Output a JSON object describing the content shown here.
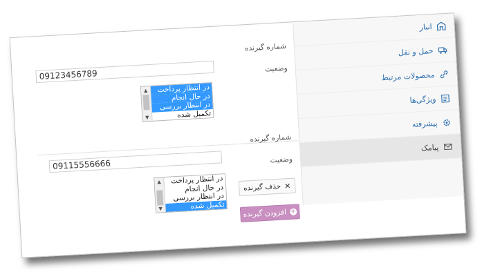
{
  "sidebar": {
    "items": [
      {
        "label": "انبار",
        "icon": "warehouse-icon"
      },
      {
        "label": "حمل و نقل",
        "icon": "truck-icon"
      },
      {
        "label": "محصولات مرتبط",
        "icon": "link-icon"
      },
      {
        "label": "ویژگی‌ها",
        "icon": "list-box-icon"
      },
      {
        "label": "پیشرفته",
        "icon": "gear-icon"
      },
      {
        "label": "پیامک",
        "icon": "envelope-icon"
      }
    ]
  },
  "recipients": [
    {
      "number_label": "شماره گیرنده",
      "number_value": "09123456789",
      "status_label": "وضعیت",
      "status_options": [
        {
          "label": "در انتظار پرداخت",
          "selected": true
        },
        {
          "label": "در حال انجام",
          "selected": true
        },
        {
          "label": "در انتظار بررسی",
          "selected": true
        },
        {
          "label": "تکمیل شده",
          "selected": false
        }
      ]
    },
    {
      "number_label": "شماره گیرنده",
      "number_value": "09115556666",
      "status_label": "وضعیت",
      "status_options": [
        {
          "label": "در انتظار پرداخت",
          "selected": false
        },
        {
          "label": "در حال انجام",
          "selected": false
        },
        {
          "label": "در انتظار بررسی",
          "selected": false
        },
        {
          "label": "تکمیل شده",
          "selected": true
        }
      ]
    }
  ],
  "buttons": {
    "remove_label": "حذف گیرنده",
    "add_label": "افزودن گیرنده"
  },
  "colors": {
    "link": "#2d6fb0",
    "selection": "#3399ff",
    "add_button": "#c88fc0"
  }
}
